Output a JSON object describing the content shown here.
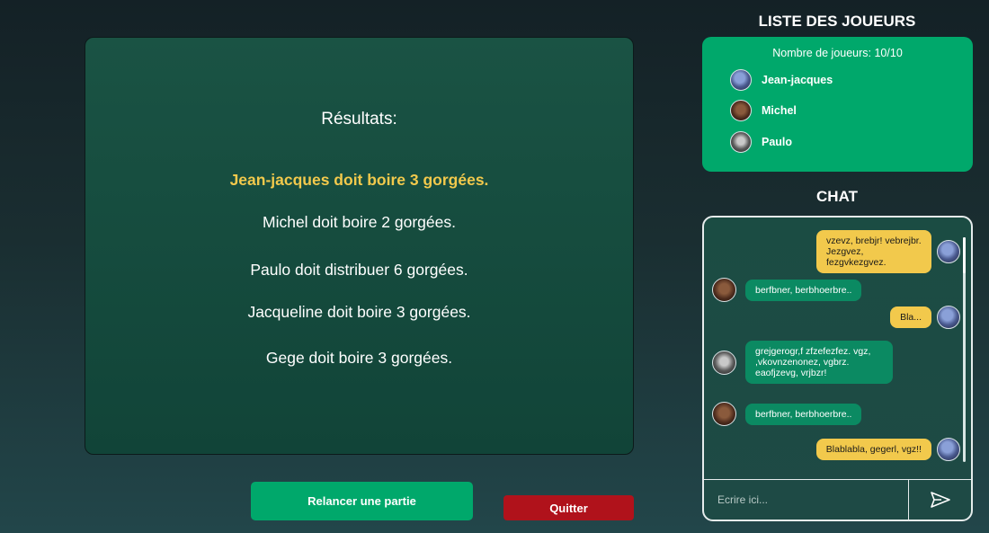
{
  "results": {
    "title": "Résultats:",
    "lines": [
      "Jean-jacques doit boire 3 gorgées.",
      "Michel doit boire 2 gorgées.",
      "Paulo doit distribuer 6 gorgées.",
      "Jacqueline doit boire 3 gorgées.",
      "Gege doit boire 3 gorgées."
    ],
    "highlight_color": "#f2c94c"
  },
  "actions": {
    "restart_label": "Relancer une partie",
    "quit_label": "Quitter",
    "restart_color": "#00a86b",
    "quit_color": "#b0121b"
  },
  "players": {
    "title": "LISTE DES JOUEURS",
    "count_label": "Nombre de joueurs: 10/10",
    "list": [
      {
        "name": "Jean-jacques",
        "avatar": "avatar-blue"
      },
      {
        "name": "Michel",
        "avatar": "avatar-brown"
      },
      {
        "name": "Paulo",
        "avatar": "avatar-grey"
      }
    ]
  },
  "chat": {
    "title": "CHAT",
    "messages": [
      {
        "side": "right",
        "text": "vzevz, brebjr! vebrejbr. Jezgvez, fezgvkezgvez.",
        "avatar": "avatar-blue"
      },
      {
        "side": "left",
        "text": "berfbner, berbhoerbre..",
        "avatar": "avatar-brown"
      },
      {
        "side": "right",
        "text": "Bla...",
        "avatar": "avatar-blue"
      },
      {
        "side": "left",
        "text": "grejgerogr,f zfzefezfez. vgz, ,vkovnzenonez, vgbrz. eaofjzevg, vrjbzr!",
        "avatar": "avatar-grey"
      },
      {
        "side": "left",
        "text": "berfbner, berbhoerbre..",
        "avatar": "avatar-brown"
      },
      {
        "side": "right",
        "text": "Blablabla, gegerl, vgz!!",
        "avatar": "avatar-blue"
      }
    ],
    "input_placeholder": "Ecrire ici...",
    "send_icon": "send-icon"
  }
}
